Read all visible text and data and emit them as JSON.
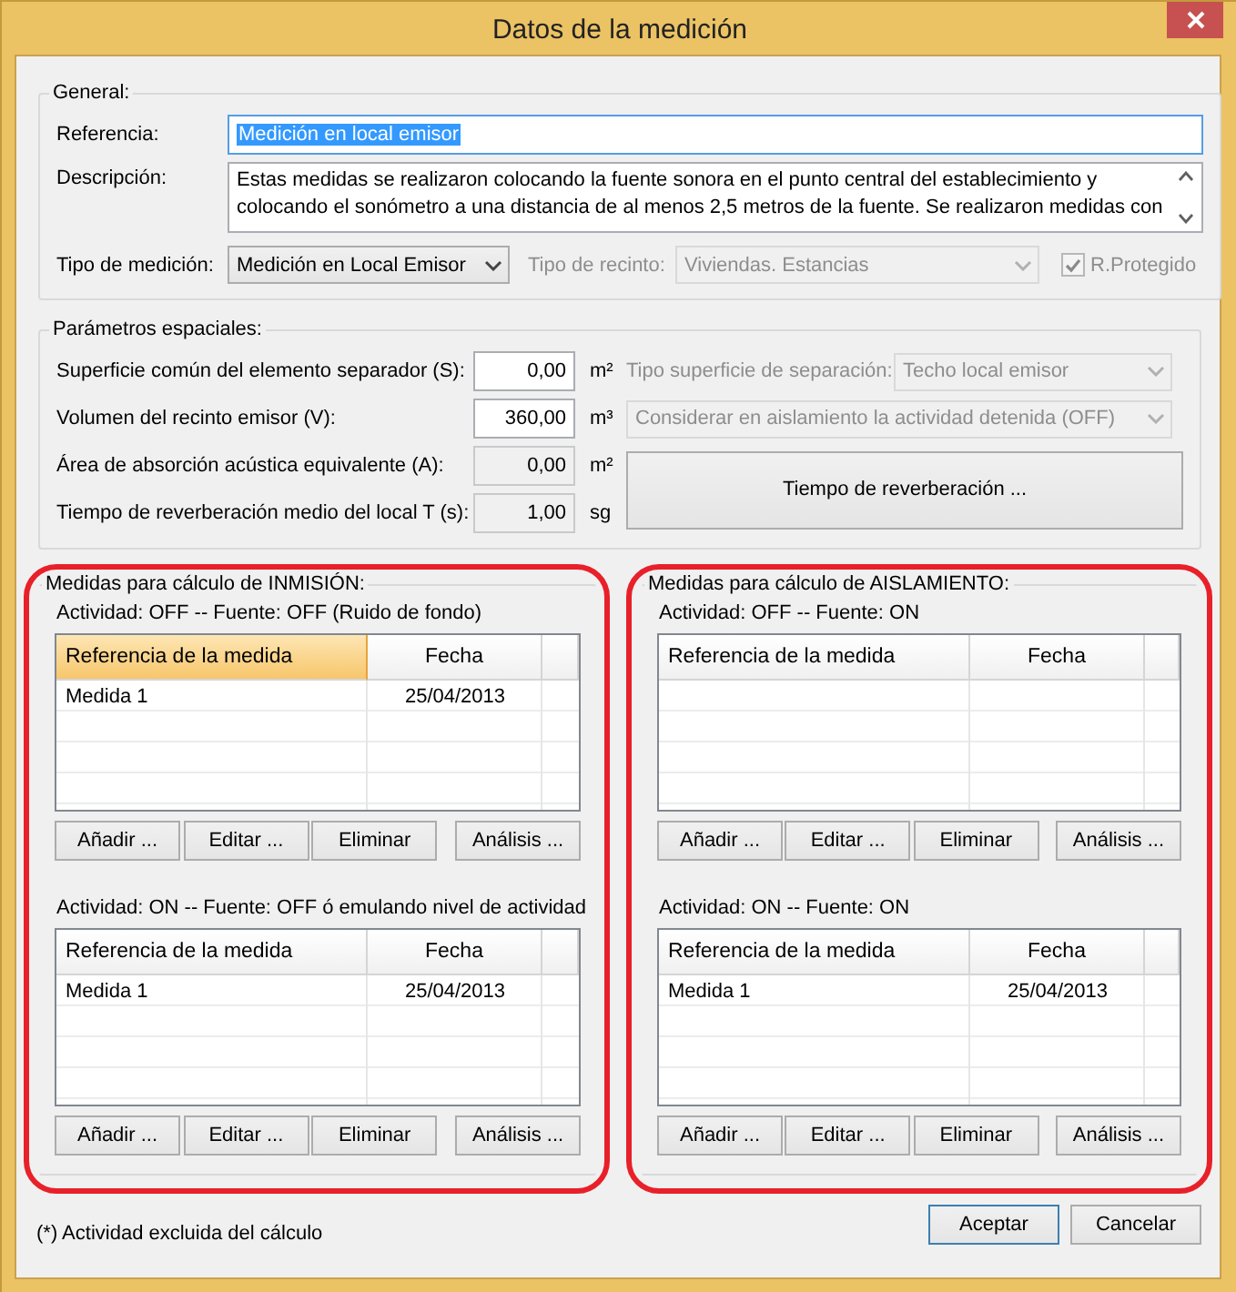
{
  "window": {
    "title": "Datos de la medición"
  },
  "general": {
    "legend": "General:",
    "referencia": {
      "label": "Referencia:",
      "value": "Medición en local emisor",
      "text_selected": true
    },
    "descripcion": {
      "label": "Descripción:",
      "lines": [
        "Estas medidas se realizaron colocando la fuente sonora en el punto central del establecimiento y",
        "colocando el sonómetro a una distancia de al menos 2,5 metros de la fuente. Se realizaron medidas con"
      ]
    },
    "tipo_medicion": {
      "label": "Tipo de medición:",
      "value": "Medición en Local Emisor",
      "disabled": false
    },
    "tipo_recinto": {
      "label": "Tipo de recinto:",
      "value": "Viviendas. Estancias",
      "disabled": true
    },
    "r_protegido": {
      "label": "R.Protegido",
      "checked": true,
      "disabled": true
    }
  },
  "parametros": {
    "legend": "Parámetros espaciales:",
    "rows": [
      {
        "label": "Superficie común del elemento separador (S):",
        "value": "0,00",
        "unit": "m²",
        "readonly": false
      },
      {
        "label": "Volumen del recinto emisor (V):",
        "value": "360,00",
        "unit": "m³",
        "readonly": false
      },
      {
        "label": "Área de absorción acústica equivalente (A):",
        "value": "0,00",
        "unit": "m²",
        "readonly": true
      },
      {
        "label": "Tiempo de reverberación medio del local T (s):",
        "value": "1,00",
        "unit": "sg",
        "readonly": true
      }
    ],
    "tipo_superficie": {
      "label": "Tipo superficie de separación:",
      "value": "Techo local emisor",
      "disabled": true
    },
    "considerar": {
      "value": "Considerar en aislamiento la actividad detenida (OFF)",
      "disabled": true
    },
    "reverb_button": "Tiempo de reverberación ..."
  },
  "sections": [
    {
      "legend": "Medidas para cálculo de INMISIÓN:",
      "highlighted": true,
      "lists": [
        {
          "caption": "Actividad: OFF -- Fuente: OFF  (Ruido de fondo)",
          "columns": [
            {
              "label": "Referencia de la medida",
              "selected": true
            },
            {
              "label": "Fecha",
              "selected": false
            }
          ],
          "rows": [
            [
              "Medida 1",
              "25/04/2013"
            ]
          ],
          "buttons": [
            "Añadir ...",
            "Editar ...",
            "Eliminar",
            "Análisis ..."
          ]
        },
        {
          "caption": "Actividad: ON -- Fuente: OFF ó emulando nivel de actividad",
          "columns": [
            {
              "label": "Referencia de la medida",
              "selected": false
            },
            {
              "label": "Fecha",
              "selected": false
            }
          ],
          "rows": [
            [
              "Medida 1",
              "25/04/2013"
            ]
          ],
          "buttons": [
            "Añadir ...",
            "Editar ...",
            "Eliminar",
            "Análisis ..."
          ]
        }
      ]
    },
    {
      "legend": "Medidas para cálculo de AISLAMIENTO:",
      "highlighted": true,
      "lists": [
        {
          "caption": "Actividad: OFF -- Fuente: ON",
          "columns": [
            {
              "label": "Referencia de la medida",
              "selected": false
            },
            {
              "label": "Fecha",
              "selected": false
            }
          ],
          "buttons": [
            "Añadir ...",
            "Editar ...",
            "Eliminar",
            "Análisis ..."
          ]
        },
        {
          "caption": "Actividad: ON -- Fuente: ON",
          "columns": [
            {
              "label": "Referencia de la medida",
              "selected": false
            },
            {
              "label": "Fecha",
              "selected": false
            }
          ],
          "rows": [
            [
              "Medida 1",
              "25/04/2013"
            ]
          ],
          "buttons": [
            "Añadir ...",
            "Editar ...",
            "Eliminar",
            "Análisis ..."
          ]
        }
      ]
    }
  ],
  "footer": {
    "note": "(*) Actividad excluida del cálculo",
    "buttons": [
      {
        "label": "Aceptar",
        "default": true
      },
      {
        "label": "Cancelar",
        "default": false
      }
    ]
  }
}
